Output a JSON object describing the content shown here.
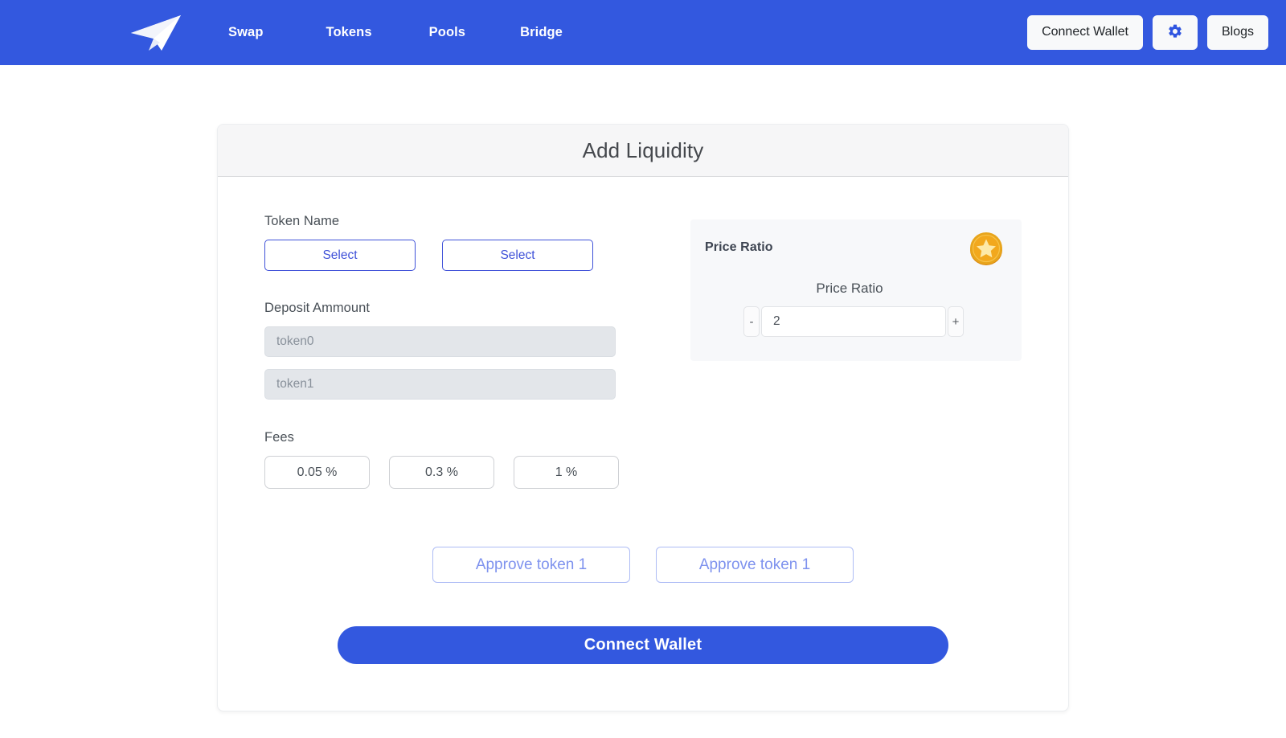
{
  "navbar": {
    "logo_icon": "paper-plane-logo",
    "links": [
      {
        "label": "Swap"
      },
      {
        "label": "Tokens"
      },
      {
        "label": "Pools"
      },
      {
        "label": "Bridge"
      }
    ],
    "connect_wallet_label": "Connect Wallet",
    "settings_icon": "gear-icon",
    "blogs_label": "Blogs",
    "background_color": "#3358df"
  },
  "card": {
    "title": "Add Liquidity",
    "token_name": {
      "label": "Token Name",
      "select_0_label": "Select",
      "select_1_label": "Select"
    },
    "deposit": {
      "label": "Deposit Ammount",
      "token0_placeholder": "token0",
      "token0_value": "",
      "token1_placeholder": "token1",
      "token1_value": ""
    },
    "fees": {
      "label": "Fees",
      "options": [
        {
          "label": "0.05 %"
        },
        {
          "label": "0.3 %"
        },
        {
          "label": "1 %"
        }
      ]
    },
    "price_ratio": {
      "title": "Price Ratio",
      "sub_label": "Price Ratio",
      "decrement_label": "-",
      "increment_label": "+",
      "value": "2",
      "coin_icon": "gold-star-coin-icon",
      "panel_color": "#f7f8fa"
    },
    "approve": {
      "token0_label": "Approve token 1",
      "token1_label": "Approve token 1"
    },
    "cta_label": "Connect Wallet"
  },
  "colors": {
    "brand_blue": "#3358df",
    "accent_blue": "#3f51d8",
    "muted_blue": "#7e92ee",
    "coin_gold": "#f0a830"
  }
}
